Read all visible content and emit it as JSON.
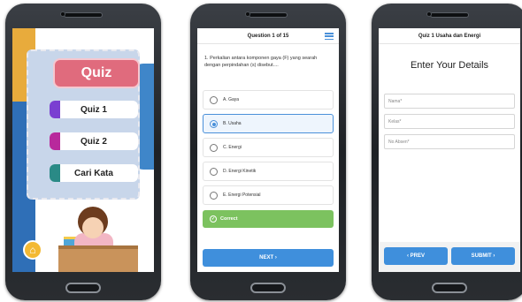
{
  "phone1": {
    "title": "Quiz",
    "menu": [
      {
        "label": "Quiz 1",
        "color": "#7a3fd1"
      },
      {
        "label": "Quiz 2",
        "color": "#b8299c"
      },
      {
        "label": "Cari Kata",
        "color": "#2a8a86"
      }
    ],
    "home_icon": "home-icon"
  },
  "phone2": {
    "header": "Question 1 of 15",
    "question": "1.   Perkalian antara komponen gaya (F) yang searah dengan perpindahan (s) disebut....",
    "options": [
      {
        "label": "A. Gaya",
        "selected": false
      },
      {
        "label": "B. Usaha",
        "selected": true
      },
      {
        "label": "C. Energi",
        "selected": false
      },
      {
        "label": "D. Energi Kinetik",
        "selected": false
      },
      {
        "label": "E. Energi Potensial",
        "selected": false
      }
    ],
    "result": "Correct",
    "next": "NEXT  ›"
  },
  "phone3": {
    "header": "Quiz 1 Usaha dan Energi",
    "title": "Enter Your Details",
    "fields": [
      "Nama*",
      "Kelas*",
      "No Absen*"
    ],
    "prev": "‹  PREV",
    "submit": "SUBMIT  ›"
  }
}
